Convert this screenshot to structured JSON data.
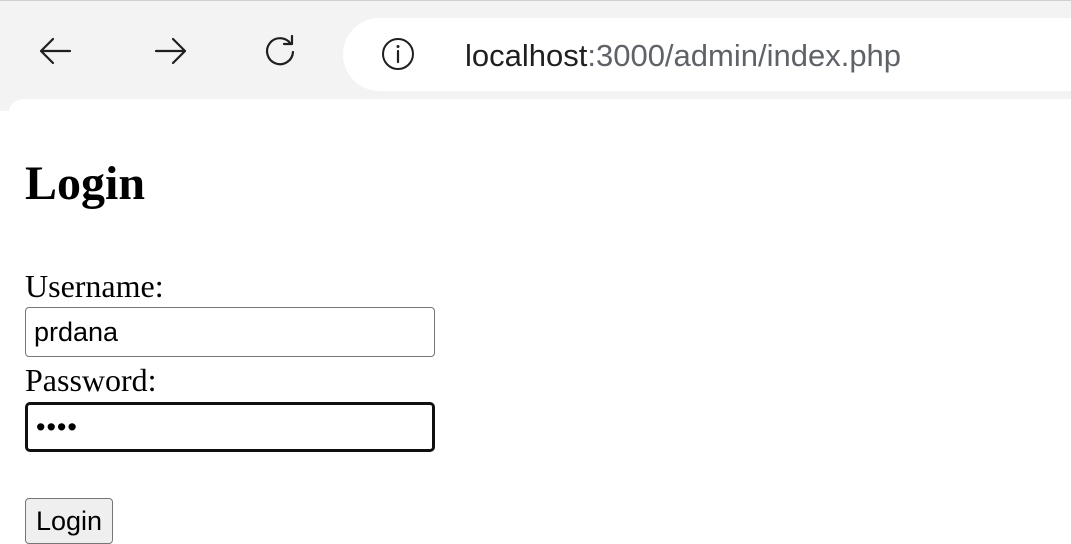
{
  "browser": {
    "url_host": "localhost",
    "url_path": ":3000/admin/index.php",
    "back_icon": "arrow-left-icon",
    "forward_icon": "arrow-right-icon",
    "reload_icon": "reload-icon",
    "site_info_icon": "info-icon"
  },
  "page": {
    "title": "Login",
    "form": {
      "username_label": "Username:",
      "username_value": "prdana",
      "password_label": "Password:",
      "password_value": "••••",
      "submit_label": "Login"
    }
  }
}
